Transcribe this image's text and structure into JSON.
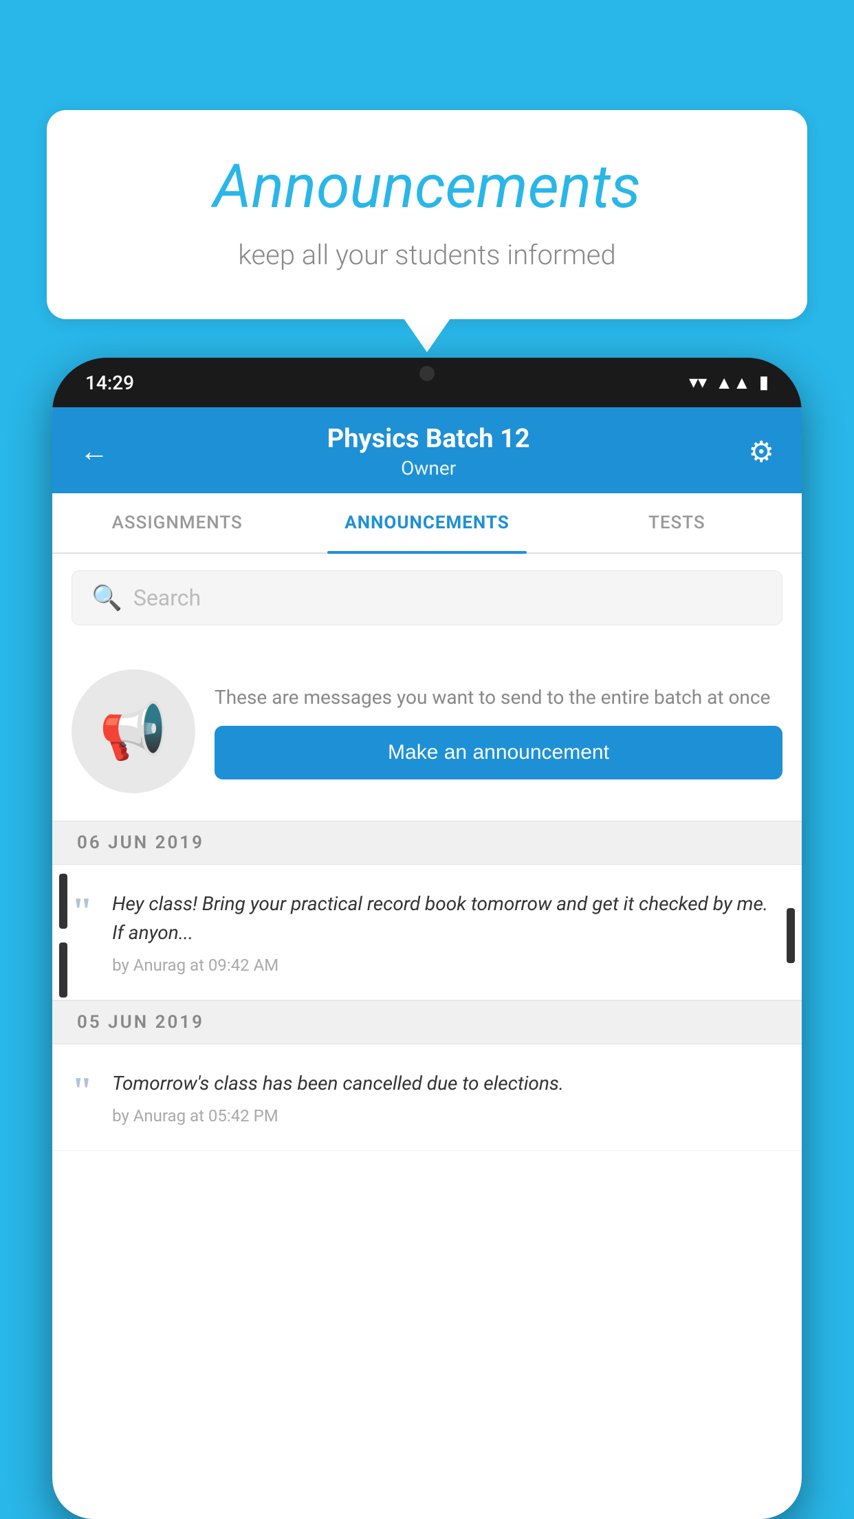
{
  "background_color": "#29b6e8",
  "speech_bubble": {
    "title": "Announcements",
    "subtitle": "keep all your students informed"
  },
  "phone": {
    "status_bar": {
      "time": "14:29",
      "icons": [
        "wifi",
        "signal",
        "battery"
      ]
    },
    "header": {
      "batch_name": "Physics Batch 12",
      "role": "Owner",
      "back_label": "←",
      "settings_label": "⚙"
    },
    "tabs": [
      {
        "label": "ASSIGNMENTS",
        "active": false
      },
      {
        "label": "ANNOUNCEMENTS",
        "active": true
      },
      {
        "label": "TESTS",
        "active": false
      }
    ],
    "search": {
      "placeholder": "Search"
    },
    "promo": {
      "description": "These are messages you want to send to the entire batch at once",
      "button_label": "Make an announcement"
    },
    "announcements": [
      {
        "date": "06  JUN  2019",
        "text": "Hey class! Bring your practical record book tomorrow and get it checked by me. If anyon...",
        "meta": "by Anurag at 09:42 AM"
      },
      {
        "date": "05  JUN  2019",
        "text": "Tomorrow's class has been cancelled due to elections.",
        "meta": "by Anurag at 05:42 PM"
      }
    ]
  }
}
